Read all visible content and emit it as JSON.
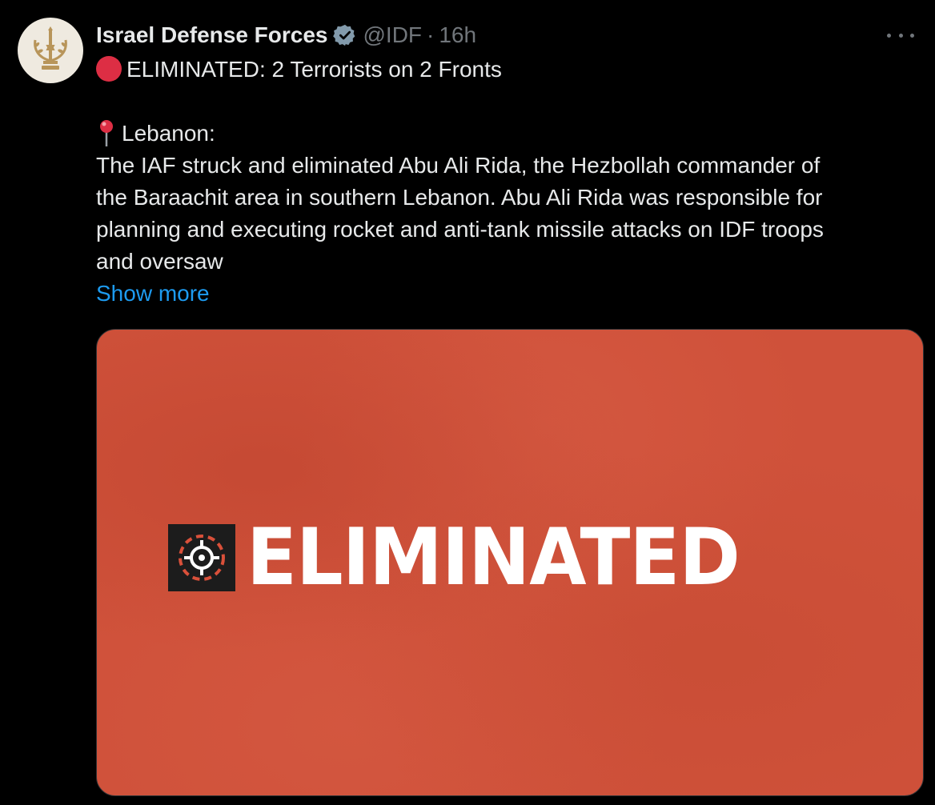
{
  "tweet": {
    "author_name": "Israel Defense Forces",
    "handle": "@IDF",
    "separator": "·",
    "time": "16h",
    "icons": {
      "avatar": "idf-emblem-icon",
      "verified": "verified-badge-icon",
      "more": "more-options-icon",
      "title_emoji": "red-circle-icon",
      "location_emoji": "round-pushpin-icon"
    },
    "headline": "ELIMINATED: 2 Terrorists on 2 Fronts",
    "location": "Lebanon:",
    "body_lines": [
      "The IAF struck and eliminated Abu Ali Rida, the Hezbollah commander of",
      "the Baraachit area in southern Lebanon. Abu Ali Rida was responsible for",
      "planning and executing rocket and anti-tank missile attacks on IDF troops",
      "and oversaw"
    ],
    "show_more": "Show more"
  },
  "media": {
    "word": "ELIMINATED",
    "icon": "crosshair-target-icon"
  },
  "colors": {
    "background": "#000000",
    "primary_text": "#e7e9ea",
    "secondary_text": "#71767b",
    "link": "#1d9bf0",
    "verified": "#829aab",
    "media_background": "#cf513a",
    "red_circle": "#dd2e44"
  }
}
